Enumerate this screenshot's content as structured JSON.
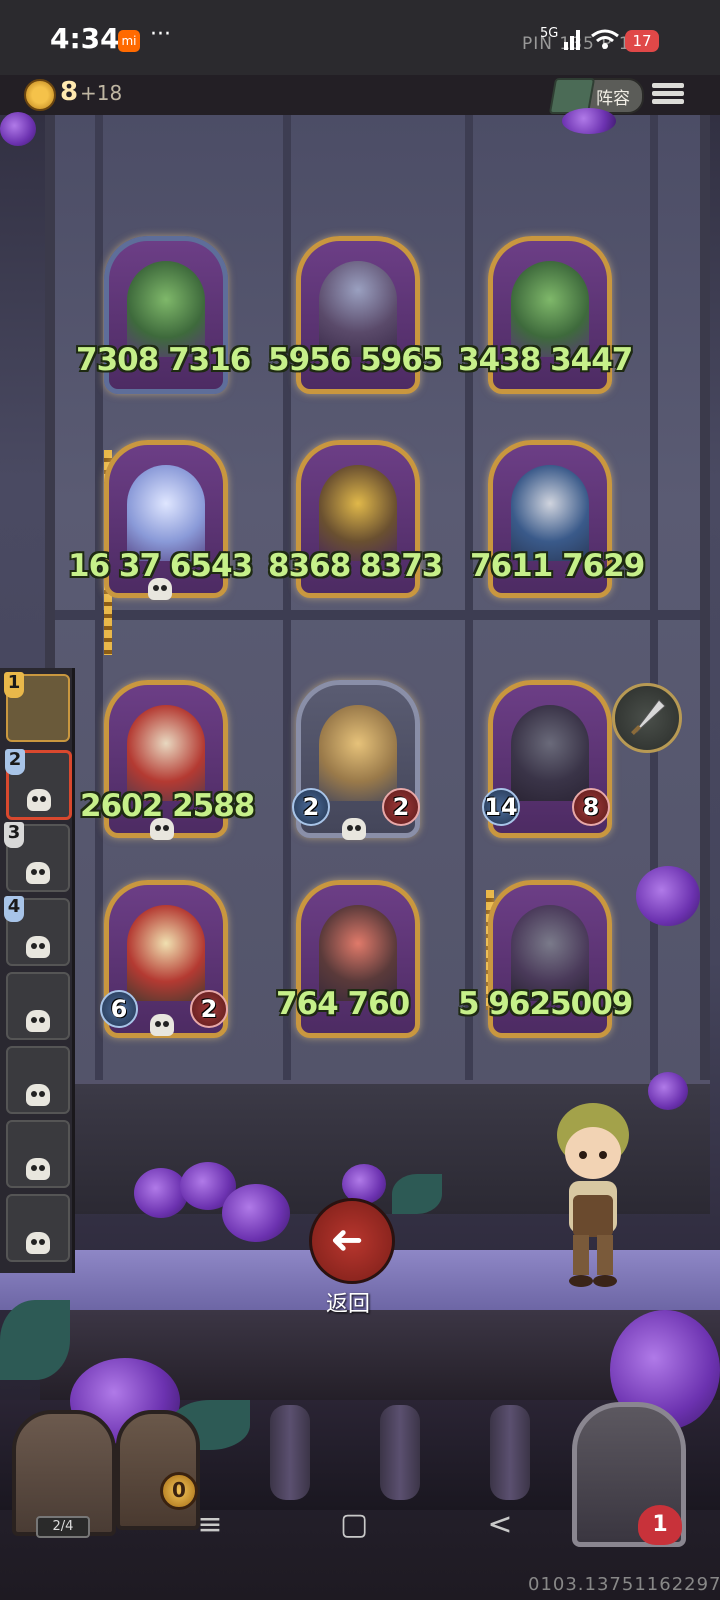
{
  "status_bar": {
    "time": "4:34",
    "mi_label": "mi",
    "overflow_dots": "···",
    "signal": "5G",
    "battery": "17",
    "ping_overlay": "PIN 135 P 160"
  },
  "hud": {
    "coins": "8",
    "coins_gain": "+18",
    "lineup_label": "阵容"
  },
  "board": {
    "rows": [
      [
        {
          "name": "forest-dryad",
          "stats": "7308 7316"
        },
        {
          "name": "mushroom-spider",
          "stats": "5956 5965"
        },
        {
          "name": "forest-dryad",
          "stats": "3438 3447"
        }
      ],
      [
        {
          "name": "frost-fairy",
          "stats": "16 37 6543"
        },
        {
          "name": "golden-hammer",
          "stats": "8368 8373"
        },
        {
          "name": "spotted-imp",
          "stats": "7611 7629"
        }
      ],
      [
        {
          "name": "hooded-monk",
          "stats": "2602 2588"
        },
        {
          "name": "pinocchio",
          "atk": "2",
          "hp": "2"
        },
        {
          "name": "shadow-musketeer",
          "atk": "14",
          "hp": "8"
        }
      ],
      [
        {
          "name": "hooded-monk",
          "atk": "6",
          "hp": "2"
        },
        {
          "name": "pirate-captain",
          "stats": "764 760"
        },
        {
          "name": "shadow-musketeer",
          "stats": "5 9625009"
        }
      ]
    ]
  },
  "team_rail": {
    "slots": [
      {
        "num": "1",
        "state": "active"
      },
      {
        "num": "2",
        "state": "selected"
      },
      {
        "num": "3",
        "state": "defeated"
      },
      {
        "num": "4",
        "state": "defeated"
      },
      {
        "num": "",
        "state": "defeated"
      },
      {
        "num": "",
        "state": "defeated"
      },
      {
        "num": "",
        "state": "defeated"
      },
      {
        "num": "",
        "state": "defeated"
      }
    ]
  },
  "controls": {
    "back_label": "返回",
    "back_arrow": "➜"
  },
  "bottom": {
    "chest_counter": "2/4",
    "gold_counter": "0",
    "lives": "1",
    "nav": [
      "≡",
      "▢",
      "<"
    ],
    "footer_code": "0103.13751162297"
  },
  "colors": {
    "stat_text": "#c6f08a",
    "card_gold_border": "#c9973f",
    "back_button": "#b8362e"
  }
}
